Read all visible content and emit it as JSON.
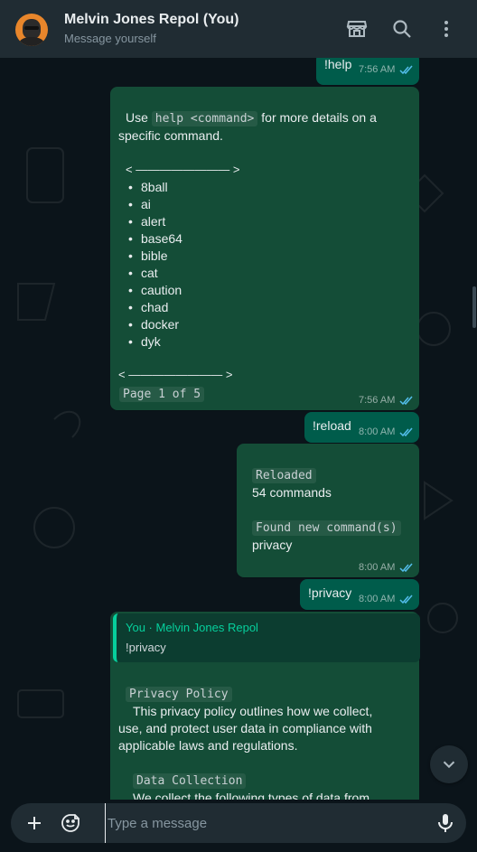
{
  "header": {
    "title": "Melvin Jones Repol (You)",
    "subtitle": "Message yourself",
    "icons": [
      "store-icon",
      "search-icon",
      "more-vertical-icon"
    ]
  },
  "messages": {
    "m1": {
      "text": "!help",
      "time": "7:56 AM"
    },
    "m2": {
      "use_prefix": "Use",
      "use_code": "help <command>",
      "use_suffix": "for more details on a",
      "use_line2": "specific command.",
      "divider_top": "< ———————— >",
      "commands": [
        "8ball",
        "ai",
        "alert",
        "base64",
        "bible",
        "cat",
        "caution",
        "chad",
        "docker",
        "dyk"
      ],
      "divider_bottom": "< ———————— >",
      "page_label": "Page 1 of 5",
      "time": "7:56 AM"
    },
    "m3": {
      "text": "!reload",
      "time": "8:00 AM"
    },
    "m4": {
      "label1": "Reloaded",
      "value1": "54 commands",
      "label2": "Found new command(s)",
      "value2": "privacy",
      "time": "8:00 AM"
    },
    "m5": {
      "text": "!privacy",
      "time": "8:00 AM"
    },
    "m6": {
      "quote_name": "You · Melvin Jones Repol",
      "quote_text": "!privacy",
      "heading1": "Privacy Policy",
      "para1_l1": "This privacy policy outlines how we collect,",
      "para1_l2": "use, and protect user data in compliance with",
      "para1_l3": "applicable laws and regulations.",
      "heading2": "Data Collection",
      "para2_l1": "We collect the following types of data from"
    }
  },
  "composer": {
    "placeholder": "Type a message",
    "icons": [
      "plus-icon",
      "sticker-icon",
      "microphone-icon"
    ]
  },
  "colors": {
    "header_bg": "#202c33",
    "bubble_out": "#005c4b",
    "bubble_bot": "#144d37",
    "accent": "#06cf9c",
    "tick_read": "#53bdeb"
  }
}
